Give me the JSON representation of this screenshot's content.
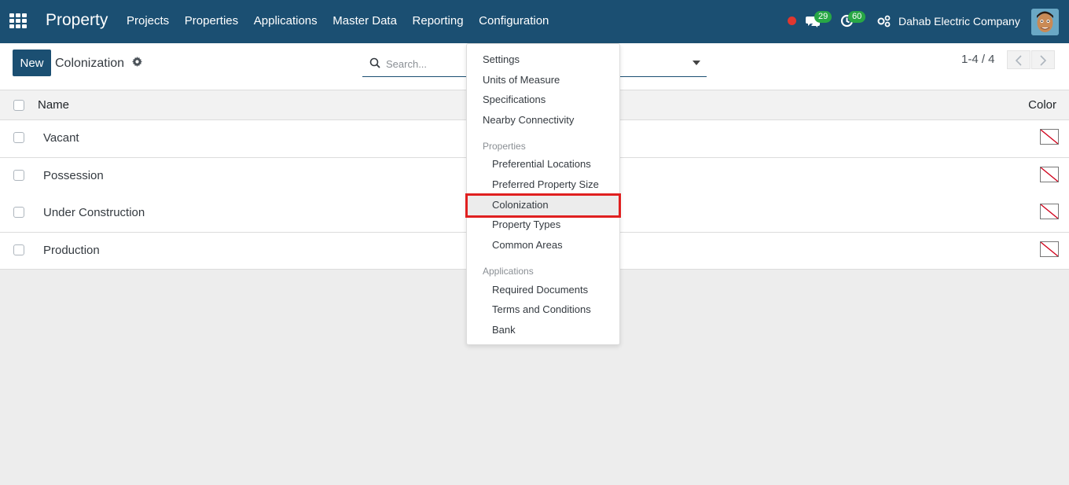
{
  "navbar": {
    "brand": "Property",
    "menu": [
      "Projects",
      "Properties",
      "Applications",
      "Master Data",
      "Reporting",
      "Configuration"
    ],
    "chat_count": "29",
    "activity_count": "60",
    "company": "Dahab Electric Company"
  },
  "control_panel": {
    "new_label": "New",
    "title": "Colonization",
    "search_placeholder": "Search...",
    "pager": "1-4 / 4"
  },
  "list": {
    "columns": {
      "name": "Name",
      "color": "Color"
    },
    "rows": [
      "Vacant",
      "Possession",
      "Under Construction",
      "Production"
    ]
  },
  "dropdown": {
    "top_items": [
      "Settings",
      "Units of Measure",
      "Specifications",
      "Nearby Connectivity"
    ],
    "properties_header": "Properties",
    "properties_items": [
      "Preferential Locations",
      "Preferred Property Size",
      "Colonization",
      "Property Types",
      "Common Areas"
    ],
    "applications_header": "Applications",
    "applications_items": [
      "Required Documents",
      "Terms and Conditions",
      "Bank"
    ],
    "selected": "Colonization"
  },
  "colors": {
    "navbar": "#1b4f72",
    "badge": "#28a745",
    "highlight_border": "#e02020"
  }
}
